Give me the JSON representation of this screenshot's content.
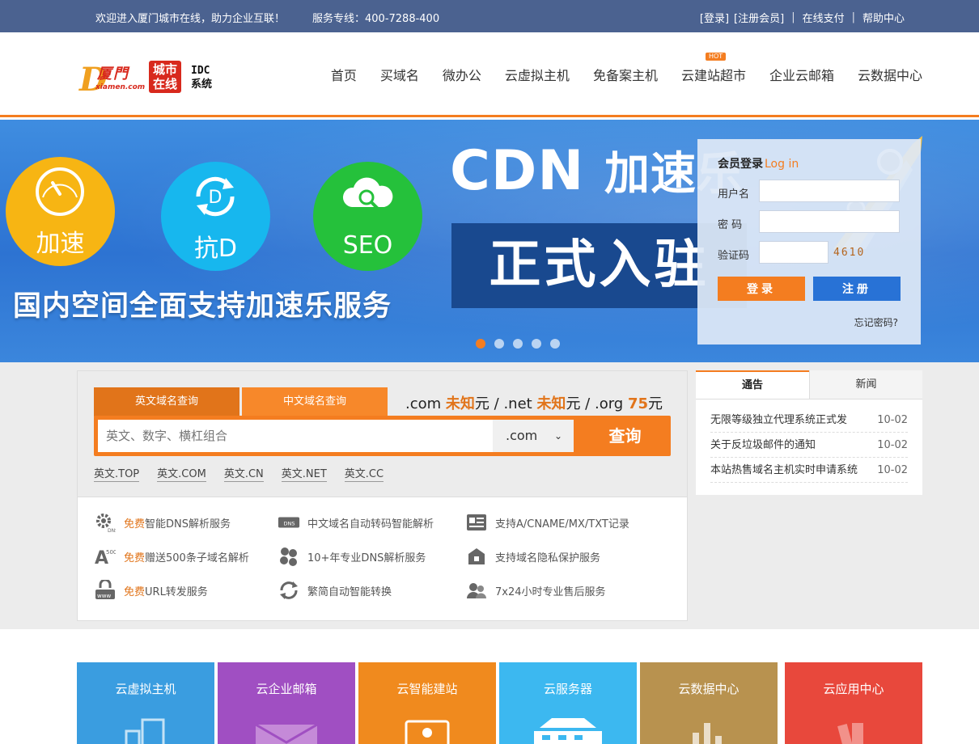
{
  "topbar": {
    "welcome": "欢迎进入厦门城市在线，助力企业互联！",
    "hotline": "服务专线：400-7288-400",
    "login": "[登录]",
    "register": "[注册会员]",
    "sep1": "|",
    "pay": "在线支付",
    "sep2": "|",
    "help": "帮助中心"
  },
  "logo": {
    "mark": "D",
    "cn": "厦門",
    "domain": "xiamen.com",
    "seal": "城市在线",
    "idc": "IDC",
    "sys": "系统"
  },
  "nav": {
    "items": [
      "首页",
      "买域名",
      "微办公",
      "云虚拟主机",
      "免备案主机",
      "云建站超市",
      "企业云邮箱",
      "云数据中心"
    ],
    "hot_badge": "HOT"
  },
  "banner": {
    "c1": "加速",
    "c2": "抗D",
    "c3": "SEO",
    "slogan": "国内空间全面支持加速乐服务",
    "cdn": "CDN",
    "cdn_cn": "加速乐",
    "box": "正式入驻"
  },
  "login": {
    "title": "会员登录",
    "title_en": "Log in",
    "username": "用户名",
    "password": "密 码",
    "captcha_label": "验证码",
    "captcha": "4610",
    "login_btn": "登录",
    "register_btn": "注册",
    "forgot": "忘记密码?"
  },
  "search": {
    "tab_en": "英文域名查询",
    "tab_cn": "中文域名查询",
    "price_com": ".com",
    "price_com_val": "未知",
    "unit1": "元 /",
    "price_net": ".net",
    "price_net_val": "未知",
    "unit2": "元 /",
    "price_org": ".org",
    "price_org_val": "75",
    "unit3": "元",
    "placeholder": "英文、数字、横杠组合",
    "suffix": ".com",
    "submit": "查询",
    "quick": [
      "英文.TOP",
      "英文.COM",
      "英文.CN",
      "英文.NET",
      "英文.CC"
    ]
  },
  "features": {
    "free": "免费",
    "f1": "智能DNS解析服务",
    "f2": "赠送500条子域名解析",
    "f3": "URL转发服务",
    "f4": "中文域名自动转码智能解析",
    "f5": "10+年专业DNS解析服务",
    "f6": "繁简自动智能转换",
    "f7": "支持A/CNAME/MX/TXT记录",
    "f8": "支持域名隐私保护服务",
    "f9": "7x24小时专业售后服务",
    "icons": [
      "dns-gear-icon",
      "subdomain-icon",
      "www-lock-icon",
      "dns-tag-icon",
      "server-cluster-icon",
      "convert-icon",
      "record-card-icon",
      "privacy-icon",
      "support-icon"
    ]
  },
  "notice": {
    "tab_notice": "通告",
    "tab_news": "新闻",
    "items": [
      {
        "title": "无限等级独立代理系统正式发",
        "date": "10-02"
      },
      {
        "title": "关于反垃圾邮件的通知",
        "date": "10-02"
      },
      {
        "title": "本站热售域名主机实时申请系统",
        "date": "10-02"
      }
    ]
  },
  "tiles": {
    "labels": [
      "云虚拟主机",
      "云企业邮箱",
      "云智能建站",
      "云服务器",
      "云数据中心",
      "云应用中心"
    ],
    "colors": [
      "#3a9de0",
      "#a04fc2",
      "#f08a1e",
      "#3cb8f0",
      "#b8924f",
      "#e8483c"
    ]
  },
  "colors": {
    "accent": "#f47d20",
    "topbar": "#4b6290",
    "blue_btn": "#2872d6"
  }
}
